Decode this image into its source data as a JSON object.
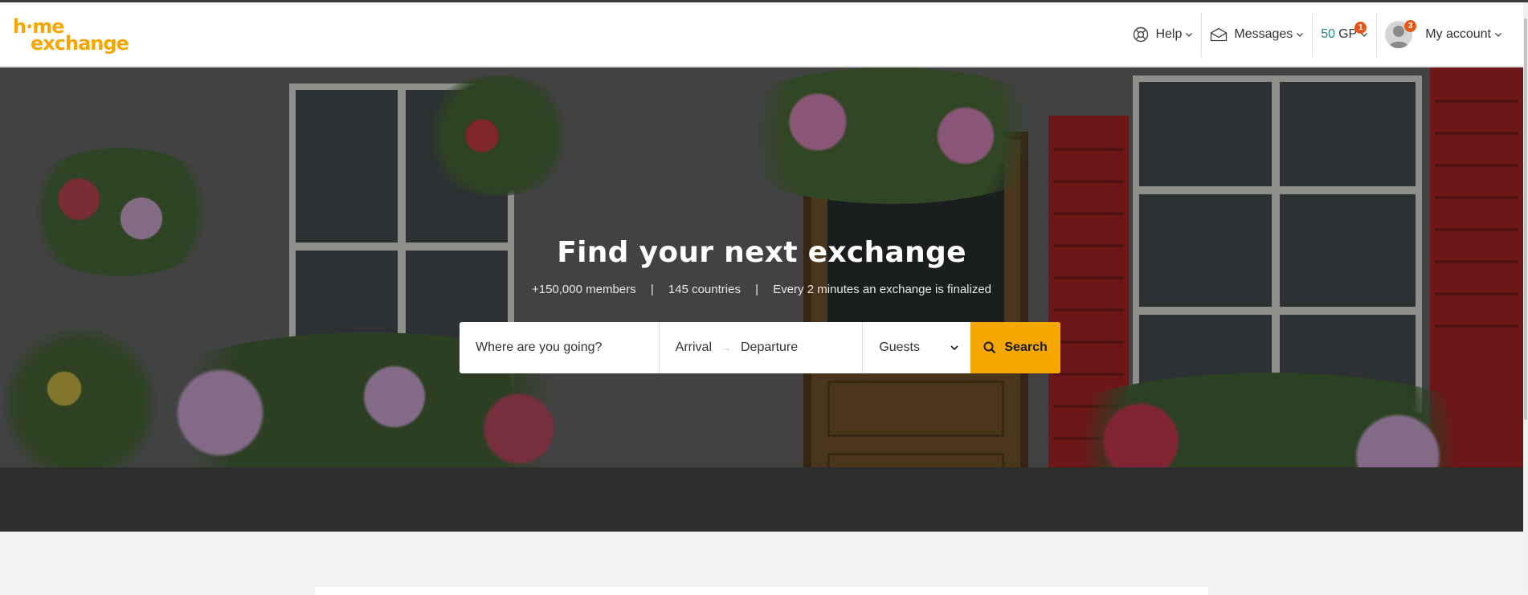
{
  "brand": {
    "logo_line1": "h·me",
    "logo_line2": "exchange",
    "accent": "#f5a700"
  },
  "nav": {
    "help_label": "Help",
    "messages_label": "Messages",
    "gp_value": "50",
    "gp_unit": "GP",
    "gp_badge": "1",
    "account_badge": "3",
    "account_label": "My account"
  },
  "hero": {
    "title": "Find your next exchange",
    "stats": {
      "members": "+150,000 members",
      "countries": "145 countries",
      "exchanges": "Every 2 minutes an exchange is finalized",
      "separator": "|"
    }
  },
  "search": {
    "destination_placeholder": "Where are you going?",
    "arrival_label": "Arrival",
    "departure_label": "Departure",
    "guests_label": "Guests",
    "button_label": "Search"
  }
}
